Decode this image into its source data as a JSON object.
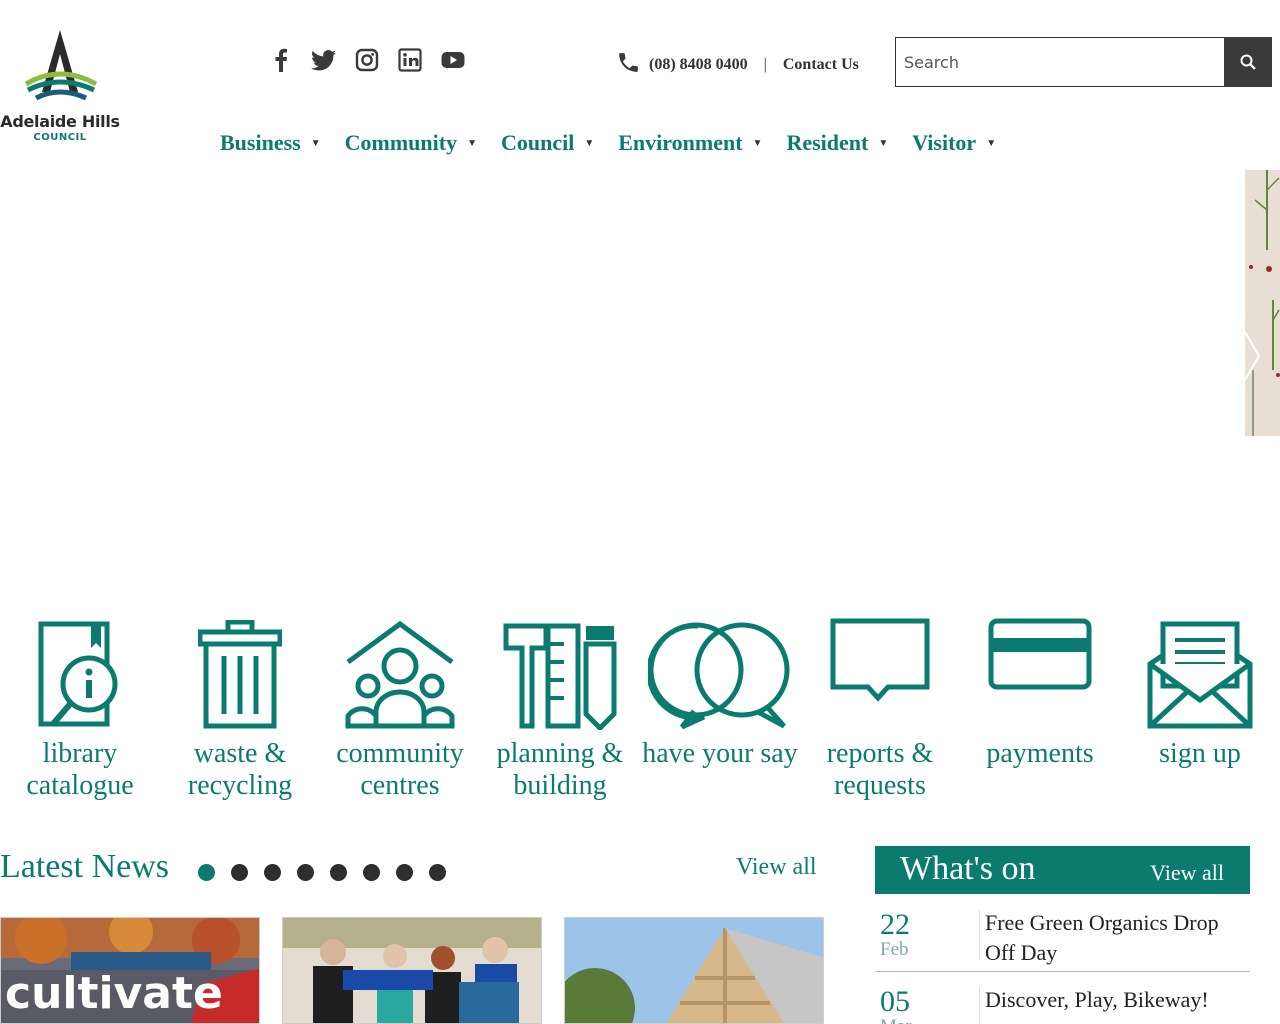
{
  "logo": {
    "name": "Adelaide Hills",
    "sub": "COUNCIL"
  },
  "social": [
    "facebook-icon",
    "twitter-icon",
    "instagram-icon",
    "linkedin-icon",
    "youtube-icon"
  ],
  "contact": {
    "phone": "(08) 8408 0400",
    "separator": "|",
    "link": "Contact Us"
  },
  "search": {
    "placeholder": "Search"
  },
  "nav": [
    "Business",
    "Community",
    "Council",
    "Environment",
    "Resident",
    "Visitor"
  ],
  "quick_links": [
    {
      "label": "library catalogue",
      "icon": "library-catalogue-icon"
    },
    {
      "label": "waste & recycling",
      "icon": "waste-bin-icon"
    },
    {
      "label": "community centres",
      "icon": "community-centres-icon"
    },
    {
      "label": "planning & building",
      "icon": "planning-tools-icon"
    },
    {
      "label": "have your say",
      "icon": "speech-bubbles-icon"
    },
    {
      "label": "reports & requests",
      "icon": "report-bubble-icon"
    },
    {
      "label": "payments",
      "icon": "card-icon"
    },
    {
      "label": "sign up",
      "icon": "envelope-icon"
    }
  ],
  "news": {
    "title": "Latest News",
    "view_all": "View all",
    "dot_count": 8,
    "active_dot": 0,
    "cards": [
      {
        "caption": "cultivate"
      },
      {
        "caption": ""
      },
      {
        "caption": ""
      }
    ]
  },
  "whats_on": {
    "title": "What's on",
    "view_all": "View all",
    "events": [
      {
        "day": "22",
        "month": "Feb",
        "title": "Free Green Organics Drop Off Day"
      },
      {
        "day": "05",
        "month": "Mar",
        "title": "Discover, Play, Bikeway!"
      }
    ]
  },
  "colors": {
    "accent": "#0a7b6e",
    "dark": "#3a3a3a"
  }
}
